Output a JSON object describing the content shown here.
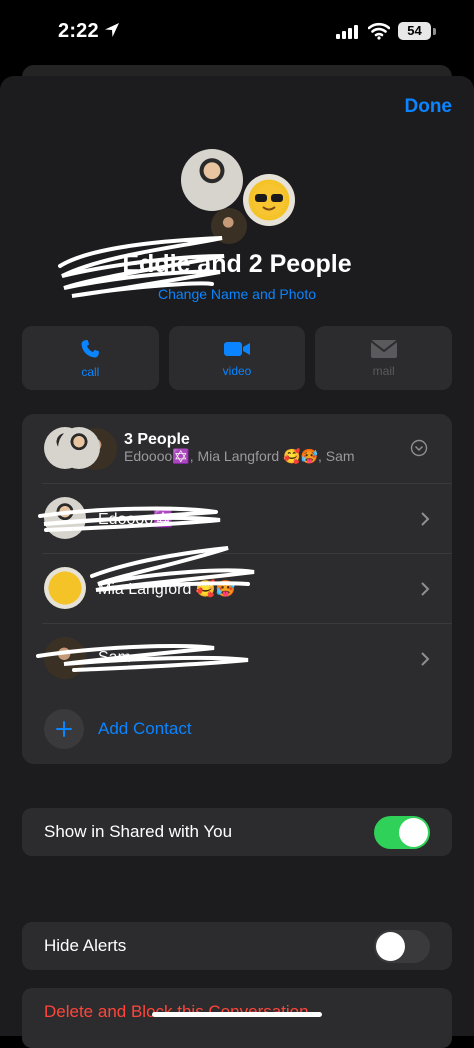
{
  "status_bar": {
    "time": "2:22",
    "battery": "54"
  },
  "header": {
    "done_label": "Done"
  },
  "group": {
    "name": "Eddie and 2 People",
    "change_label": "Change Name and Photo"
  },
  "actions": [
    {
      "label": "call",
      "icon": "phone-icon",
      "enabled": true
    },
    {
      "label": "video",
      "icon": "video-icon",
      "enabled": true
    },
    {
      "label": "mail",
      "icon": "mail-icon",
      "enabled": false
    }
  ],
  "members": {
    "title": "3 People",
    "subtitle": "Edoooo✡️, Mia Langford 🥰🥵, Sam",
    "contacts": [
      {
        "name": "Edoooo✡️"
      },
      {
        "name": "Mia Langford 🥰🥵"
      },
      {
        "name": "Sam"
      }
    ],
    "add_label": "Add Contact"
  },
  "shared": {
    "label": "Show in Shared with You",
    "on": true
  },
  "alerts": {
    "label": "Hide Alerts",
    "on": false
  },
  "danger": {
    "label": "Delete and Block this Conversation"
  },
  "colors": {
    "accent": "#0a84ff",
    "toggle_on": "#30d158",
    "destructive": "#ff453a",
    "background": "#1c1c1e",
    "cell": "#2c2c2e"
  }
}
